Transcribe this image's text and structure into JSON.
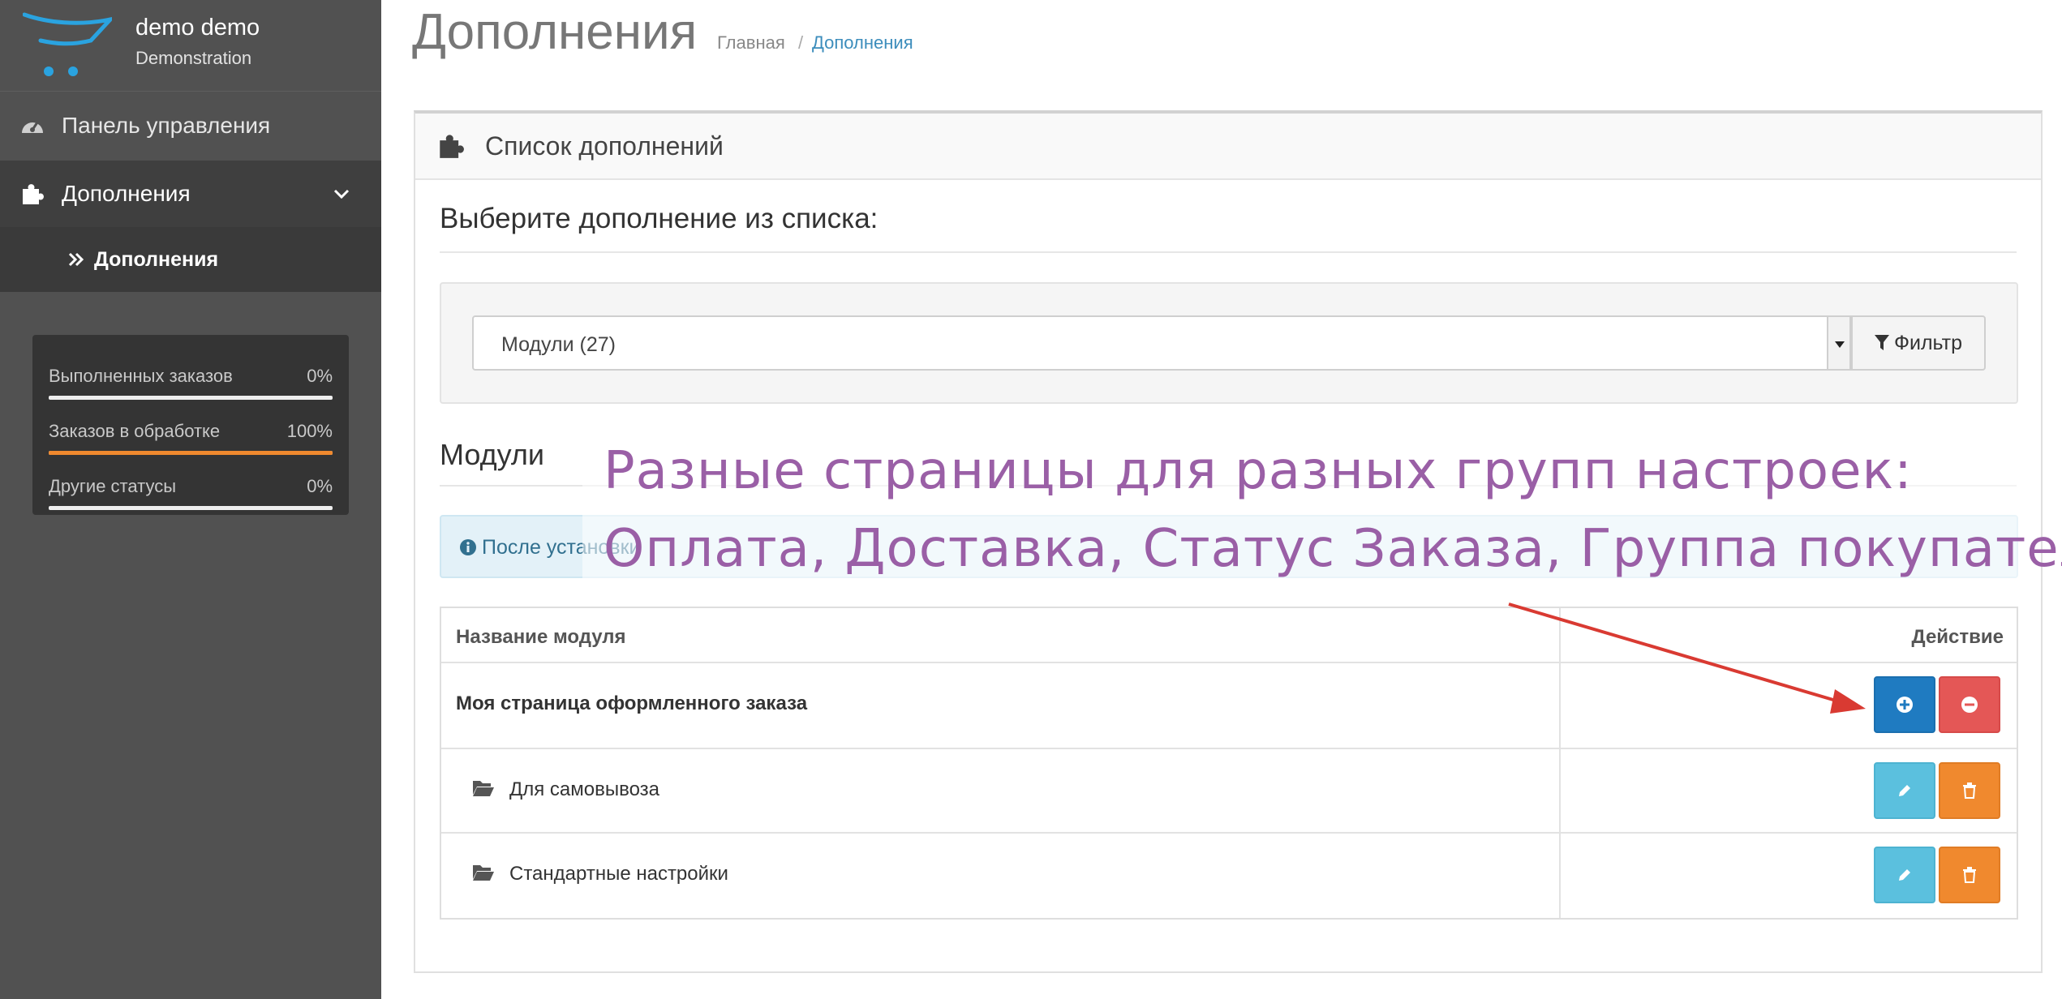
{
  "sidebar": {
    "user_name": "demo demo",
    "user_role": "Demonstration",
    "nav": {
      "dashboard": "Панель управления",
      "addons": "Дополнения",
      "addons_sub": "Дополнения"
    },
    "stats": [
      {
        "label": "Выполненных заказов",
        "value": "0%",
        "percent": 0
      },
      {
        "label": "Заказов в обработке",
        "value": "100%",
        "percent": 100
      },
      {
        "label": "Другие статусы",
        "value": "0%",
        "percent": 0
      }
    ]
  },
  "header": {
    "title": "Дополнения",
    "breadcrumb": {
      "home": "Главная",
      "separator": "/",
      "current": "Дополнения"
    }
  },
  "panel": {
    "title": "Список дополнений",
    "select_title": "Выберите дополнение из списка:",
    "select_value": "Модули (27)",
    "filter_label": "Фильтр",
    "section_title": "Модули",
    "info_text": "После установки"
  },
  "annotation": {
    "line1": "Разные страницы для разных групп настроек:",
    "line2": "Оплата, Доставка, Статус Заказа, Группа покупателя",
    "color": "#9a5fa6",
    "arrow_color": "#d93a32"
  },
  "table": {
    "headers": {
      "name": "Название модуля",
      "action": "Действие"
    },
    "module_title": "Моя страница оформленного заказа",
    "rows": [
      {
        "label": "Для самовывоза"
      },
      {
        "label": "Стандартные настройки"
      }
    ]
  },
  "colors": {
    "sidebar_bg": "#515151",
    "accent_blue": "#3c8dbc",
    "progress_orange": "#f0892e"
  }
}
